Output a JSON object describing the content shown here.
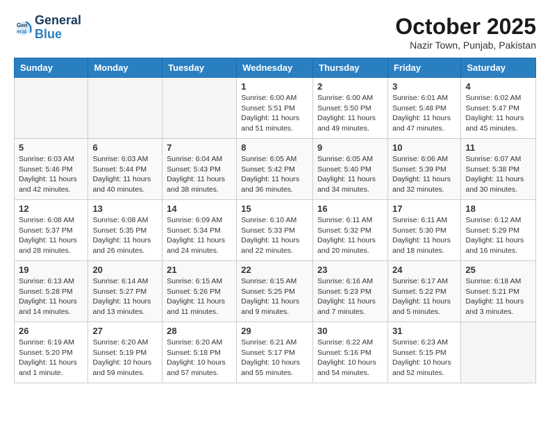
{
  "header": {
    "logo_line1": "General",
    "logo_line2": "Blue",
    "month": "October 2025",
    "location": "Nazir Town, Punjab, Pakistan"
  },
  "weekdays": [
    "Sunday",
    "Monday",
    "Tuesday",
    "Wednesday",
    "Thursday",
    "Friday",
    "Saturday"
  ],
  "weeks": [
    [
      {
        "day": "",
        "info": ""
      },
      {
        "day": "",
        "info": ""
      },
      {
        "day": "",
        "info": ""
      },
      {
        "day": "1",
        "info": "Sunrise: 6:00 AM\nSunset: 5:51 PM\nDaylight: 11 hours\nand 51 minutes."
      },
      {
        "day": "2",
        "info": "Sunrise: 6:00 AM\nSunset: 5:50 PM\nDaylight: 11 hours\nand 49 minutes."
      },
      {
        "day": "3",
        "info": "Sunrise: 6:01 AM\nSunset: 5:48 PM\nDaylight: 11 hours\nand 47 minutes."
      },
      {
        "day": "4",
        "info": "Sunrise: 6:02 AM\nSunset: 5:47 PM\nDaylight: 11 hours\nand 45 minutes."
      }
    ],
    [
      {
        "day": "5",
        "info": "Sunrise: 6:03 AM\nSunset: 5:46 PM\nDaylight: 11 hours\nand 42 minutes."
      },
      {
        "day": "6",
        "info": "Sunrise: 6:03 AM\nSunset: 5:44 PM\nDaylight: 11 hours\nand 40 minutes."
      },
      {
        "day": "7",
        "info": "Sunrise: 6:04 AM\nSunset: 5:43 PM\nDaylight: 11 hours\nand 38 minutes."
      },
      {
        "day": "8",
        "info": "Sunrise: 6:05 AM\nSunset: 5:42 PM\nDaylight: 11 hours\nand 36 minutes."
      },
      {
        "day": "9",
        "info": "Sunrise: 6:05 AM\nSunset: 5:40 PM\nDaylight: 11 hours\nand 34 minutes."
      },
      {
        "day": "10",
        "info": "Sunrise: 6:06 AM\nSunset: 5:39 PM\nDaylight: 11 hours\nand 32 minutes."
      },
      {
        "day": "11",
        "info": "Sunrise: 6:07 AM\nSunset: 5:38 PM\nDaylight: 11 hours\nand 30 minutes."
      }
    ],
    [
      {
        "day": "12",
        "info": "Sunrise: 6:08 AM\nSunset: 5:37 PM\nDaylight: 11 hours\nand 28 minutes."
      },
      {
        "day": "13",
        "info": "Sunrise: 6:08 AM\nSunset: 5:35 PM\nDaylight: 11 hours\nand 26 minutes."
      },
      {
        "day": "14",
        "info": "Sunrise: 6:09 AM\nSunset: 5:34 PM\nDaylight: 11 hours\nand 24 minutes."
      },
      {
        "day": "15",
        "info": "Sunrise: 6:10 AM\nSunset: 5:33 PM\nDaylight: 11 hours\nand 22 minutes."
      },
      {
        "day": "16",
        "info": "Sunrise: 6:11 AM\nSunset: 5:32 PM\nDaylight: 11 hours\nand 20 minutes."
      },
      {
        "day": "17",
        "info": "Sunrise: 6:11 AM\nSunset: 5:30 PM\nDaylight: 11 hours\nand 18 minutes."
      },
      {
        "day": "18",
        "info": "Sunrise: 6:12 AM\nSunset: 5:29 PM\nDaylight: 11 hours\nand 16 minutes."
      }
    ],
    [
      {
        "day": "19",
        "info": "Sunrise: 6:13 AM\nSunset: 5:28 PM\nDaylight: 11 hours\nand 14 minutes."
      },
      {
        "day": "20",
        "info": "Sunrise: 6:14 AM\nSunset: 5:27 PM\nDaylight: 11 hours\nand 13 minutes."
      },
      {
        "day": "21",
        "info": "Sunrise: 6:15 AM\nSunset: 5:26 PM\nDaylight: 11 hours\nand 11 minutes."
      },
      {
        "day": "22",
        "info": "Sunrise: 6:15 AM\nSunset: 5:25 PM\nDaylight: 11 hours\nand 9 minutes."
      },
      {
        "day": "23",
        "info": "Sunrise: 6:16 AM\nSunset: 5:23 PM\nDaylight: 11 hours\nand 7 minutes."
      },
      {
        "day": "24",
        "info": "Sunrise: 6:17 AM\nSunset: 5:22 PM\nDaylight: 11 hours\nand 5 minutes."
      },
      {
        "day": "25",
        "info": "Sunrise: 6:18 AM\nSunset: 5:21 PM\nDaylight: 11 hours\nand 3 minutes."
      }
    ],
    [
      {
        "day": "26",
        "info": "Sunrise: 6:19 AM\nSunset: 5:20 PM\nDaylight: 11 hours\nand 1 minute."
      },
      {
        "day": "27",
        "info": "Sunrise: 6:20 AM\nSunset: 5:19 PM\nDaylight: 10 hours\nand 59 minutes."
      },
      {
        "day": "28",
        "info": "Sunrise: 6:20 AM\nSunset: 5:18 PM\nDaylight: 10 hours\nand 57 minutes."
      },
      {
        "day": "29",
        "info": "Sunrise: 6:21 AM\nSunset: 5:17 PM\nDaylight: 10 hours\nand 55 minutes."
      },
      {
        "day": "30",
        "info": "Sunrise: 6:22 AM\nSunset: 5:16 PM\nDaylight: 10 hours\nand 54 minutes."
      },
      {
        "day": "31",
        "info": "Sunrise: 6:23 AM\nSunset: 5:15 PM\nDaylight: 10 hours\nand 52 minutes."
      },
      {
        "day": "",
        "info": ""
      }
    ]
  ]
}
